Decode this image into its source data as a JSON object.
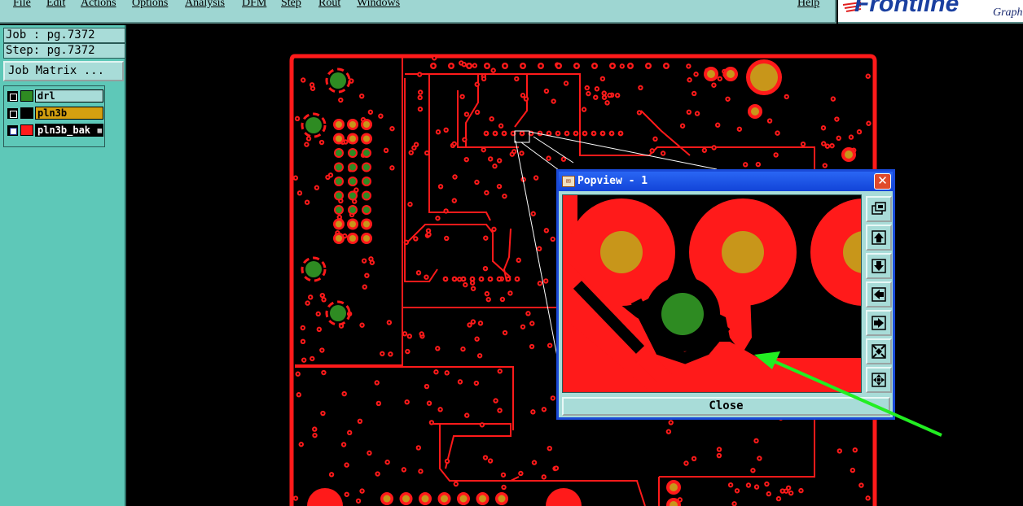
{
  "menu": {
    "items": [
      "File",
      "Edit",
      "Actions",
      "Options",
      "Analysis",
      "DFM",
      "Step",
      "Rout",
      "Windows"
    ],
    "help": "Help"
  },
  "brand": {
    "logo": "Frontline",
    "sub": "Graph"
  },
  "left_panel": {
    "job_label": "Job : pg.7372",
    "step_label": "Step: pg.7372",
    "job_matrix_button": "Job Matrix ..."
  },
  "layers": [
    {
      "name": "drl",
      "color": "#2e8b22",
      "name_bg": "#a8dcd8",
      "active": false
    },
    {
      "name": "pln3b",
      "color": "#000000",
      "name_bg": "#d4a010",
      "active": false
    },
    {
      "name": "pln3b_bak",
      "color": "#ff1a1a",
      "name_bg": "#000000",
      "active": true
    }
  ],
  "popview": {
    "title": "Popview - 1",
    "close_label": "Close",
    "close_icon": "close-x-icon",
    "tools": [
      "zoom-fit-icon",
      "pan-up-icon",
      "pan-down-icon",
      "pan-left-icon",
      "pan-right-icon",
      "zoom-in-icon",
      "zoom-out-icon"
    ]
  },
  "colors": {
    "copper": "#ff1a1a",
    "drill": "#2e8b22",
    "pad": "#c8961a",
    "annotation_arrow": "#22ee22"
  }
}
